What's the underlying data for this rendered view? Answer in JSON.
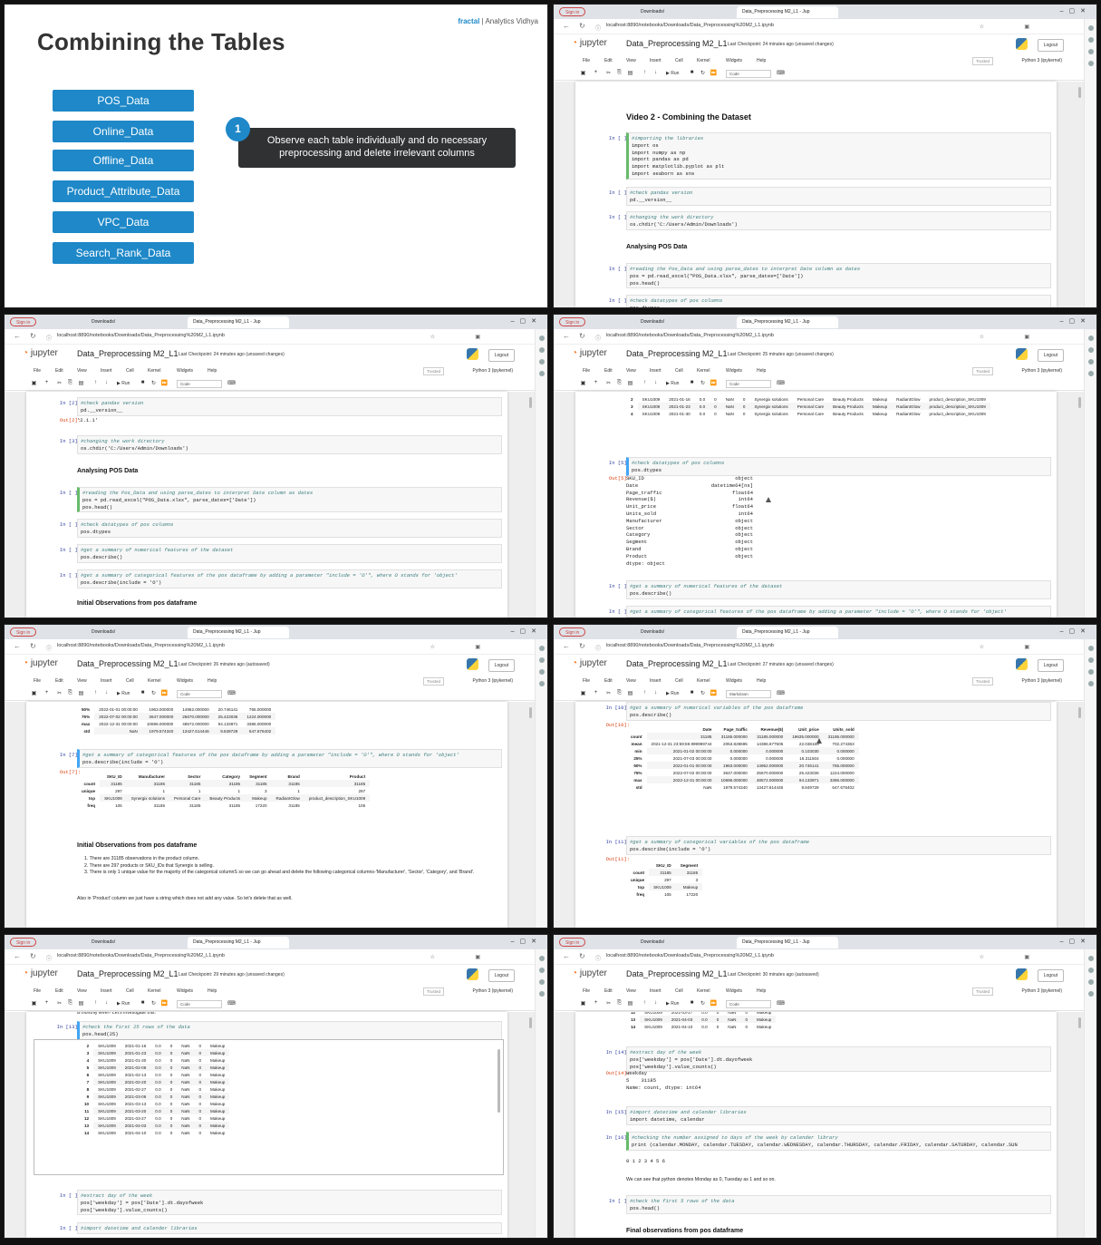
{
  "slide": {
    "title": "Combining the Tables",
    "logo_left": "fractal",
    "logo_right": "Analytics Vidhya",
    "buttons": [
      "POS_Data",
      "Online_Data",
      "Offline_Data",
      "Product_Attribute_Data",
      "VPC_Data",
      "Search_Rank_Data"
    ],
    "step_number": "1",
    "step_text": "Observe each table individually and do necessary preprocessing and delete irrelevant columns"
  },
  "browser": {
    "sign_in": "Sign in",
    "tab_downloads": "Downloads/",
    "tab_notebook": "Data_Preprocessing M2_L1 - Jup",
    "url": "localhost:8890/notebooks/Downloads/Data_Preprocessing%20M2_L1.ipynb"
  },
  "jupyter": {
    "logo": "jupyter",
    "notebook_title": "Data_Preprocessing M2_L1",
    "menu": [
      "File",
      "Edit",
      "View",
      "Insert",
      "Cell",
      "Kernel",
      "Widgets",
      "Help"
    ],
    "trusted": "Trusted",
    "kernel": "Python 3 (ipykernel)",
    "logout": "Logout",
    "run_label": "Run",
    "celltype_code": "Code",
    "celltype_markdown": "Markdown"
  },
  "panels": {
    "p1": {
      "checkpoint": "Last Checkpoint: 24 minutes ago  (unsaved changes)",
      "heading": "Video 2 - Combining the Dataset",
      "cell1_prompt": "In [ ]:",
      "cell1_code": [
        "#importing the libraries",
        "import os",
        "import numpy as np",
        "import pandas as pd",
        "import matplotlib.pyplot as plt",
        "import seaborn as sns"
      ],
      "cell2_prompt": "In [ ]:",
      "cell2_code": [
        "#check pandas version",
        "pd.__version__"
      ],
      "cell3_prompt": "In [ ]:",
      "cell3_code": [
        "#changing the work directory",
        "os.chdir('C:/Users/Admin/Downloads')"
      ],
      "heading2": "Analysing POS Data",
      "cell4_prompt": "In [ ]:",
      "cell4_code": [
        "#reading the Pos_Data and using parse_dates to interpret Date column as dates",
        "pos = pd.read_excel(\"POS_Data.xlsx\", parse_dates=['Date'])",
        "pos.head()"
      ],
      "cell5_prompt": "In [ ]:",
      "cell5_code": [
        "#check datatypes of pos columns",
        "pos.dtypes"
      ]
    },
    "p2": {
      "checkpoint": "Last Checkpoint: 24 minutes ago  (unsaved changes)",
      "c1_prompt": "In [2]:",
      "c1_code": [
        "#check pandas version",
        "pd.__version__"
      ],
      "c1_out_prompt": "Out[2]:",
      "c1_out": "'2.1.1'",
      "c2_prompt": "In [3]:",
      "c2_code": [
        "#changing the work directory",
        "os.chdir('C:/Users/Admin/Downloads')"
      ],
      "heading": "Analysing POS Data",
      "c3_prompt": "In [ ]:",
      "c3_code": [
        "#reading the Pos_Data and using parse_dates to interpret Date column as dates",
        "pos = pd.read_excel(\"POS_Data.xlsx\", parse_dates=['Date'])",
        "pos.head()"
      ],
      "c4_prompt": "In [ ]:",
      "c4_code": [
        "#check datatypes of pos columns",
        "pos.dtypes"
      ],
      "c5_prompt": "In [ ]:",
      "c5_code": [
        "#get a summary of numerical features of the dataset",
        "pos.describe()"
      ],
      "c6_prompt": "In [ ]:",
      "c6_code": [
        "#get a summary of categorical features of the pos dataframe by adding a parameter \"include = 'O'\", where O stands for 'object'",
        "pos.describe(include = 'O')"
      ],
      "heading2": "Initial Observations from pos dataframe"
    },
    "p3": {
      "checkpoint": "Last Checkpoint: 25 minutes ago  (unsaved changes)",
      "head_rows": [
        [
          "2",
          "SKU1009",
          "2021-01-16",
          "0.0",
          "0",
          "NaN",
          "0",
          "Synergix solutions",
          "Personal Care",
          "Beauty Products",
          "Makeup",
          "RadiantGlow",
          "product_description_SKU1009"
        ],
        [
          "3",
          "SKU1009",
          "2021-01-23",
          "0.0",
          "0",
          "NaN",
          "0",
          "Synergix solutions",
          "Personal Care",
          "Beauty Products",
          "Makeup",
          "RadiantGlow",
          "product_description_SKU1009"
        ],
        [
          "4",
          "SKU1009",
          "2021-01-30",
          "0.0",
          "0",
          "NaN",
          "0",
          "Synergix solutions",
          "Personal Care",
          "Beauty Products",
          "Makeup",
          "RadiantGlow",
          "product_description_SKU1009"
        ]
      ],
      "c1_prompt": "In [5]:",
      "c1_code": [
        "#check datatypes of pos columns",
        "pos.dtypes"
      ],
      "c1_out_prompt": "Out[5]:",
      "dtypes": [
        [
          "SKU_ID",
          "object"
        ],
        [
          "Date",
          "datetime64[ns]"
        ],
        [
          "Page_traffic",
          "float64"
        ],
        [
          "Revenue($)",
          "int64"
        ],
        [
          "Unit_price",
          "float64"
        ],
        [
          "Units_sold",
          "int64"
        ],
        [
          "Manufacturer",
          "object"
        ],
        [
          "Sector",
          "object"
        ],
        [
          "Category",
          "object"
        ],
        [
          "Segment",
          "object"
        ],
        [
          "Brand",
          "object"
        ],
        [
          "Product",
          "object"
        ]
      ],
      "dtype_footer": "dtype: object",
      "c2_prompt": "In [ ]:",
      "c2_code": [
        "#get a summary of numerical features of the dataset",
        "pos.describe()"
      ],
      "c3_prompt": "In [ ]:",
      "c3_code": [
        "#get a summary of categorical features of the pos dataframe by adding a parameter \"include = 'O'\", where O stands for 'object'"
      ]
    },
    "p4": {
      "checkpoint": "Last Checkpoint: 26 minutes ago  (autosaved)",
      "num_rows": [
        [
          "50%",
          "2022-01-01 00:00:00",
          "1963.000000",
          "14952.000000",
          "20.746141",
          "765.000000"
        ],
        [
          "75%",
          "2022-07-02 00:00:00",
          "3647.000000",
          "25670.000000",
          "25.423036",
          "1224.000000"
        ],
        [
          "max",
          "2022-12-31 00:00:00",
          "10696.000000",
          "48572.000000",
          "94.133971",
          "3386.000000"
        ],
        [
          "std",
          "NaN",
          "1979.574340",
          "13427.614446",
          "9.849729",
          "647.676402"
        ]
      ],
      "c1_prompt": "In [7]:",
      "c1_code": [
        "#get a summary of categorical features of the pos dataframe by adding a parameter \"include = 'O'\", where O stands for 'object'",
        "pos.describe(include = 'O')"
      ],
      "c1_out_prompt": "Out[7]:",
      "cat_headers": [
        "",
        "SKU_ID",
        "Manufacturer",
        "Sector",
        "Category",
        "Segment",
        "Brand",
        "Product"
      ],
      "cat_rows": [
        [
          "count",
          "31185",
          "31185",
          "31185",
          "31185",
          "31185",
          "31185",
          "31185"
        ],
        [
          "unique",
          "297",
          "1",
          "1",
          "1",
          "3",
          "1",
          "297"
        ],
        [
          "top",
          "SKU1009",
          "Synergix solutions",
          "Personal Care",
          "Beauty Products",
          "Makeup",
          "RadiantGlow",
          "product_description_SKU1009"
        ],
        [
          "freq",
          "105",
          "31185",
          "31185",
          "31185",
          "17220",
          "31185",
          "105"
        ]
      ],
      "heading": "Initial Observations from pos dataframe",
      "obs": [
        "1. There are 31185 observations in the product column.",
        "2. There are 297 products or SKU_IDs that Synergix is selling.",
        "3. There is only 1 unique value for the majority of the categorical columnS so we can go ahead and delete the following categorical columns-'Manufacturer', 'Sector', 'Category', and 'Brand'."
      ],
      "note": "Also in 'Product' column we just have a string which does not add any value. So let's delete that as well."
    },
    "p5": {
      "checkpoint": "Last Checkpoint: 27 minutes ago  (unsaved changes)",
      "c1_prompt": "In [10]:",
      "c1_code": [
        "#get a summary of numerical variables of the pos dataframe",
        "pos.describe()"
      ],
      "c1_out_prompt": "Out[10]:",
      "num_headers": [
        "",
        "Date",
        "Page_traffic",
        "Revenue($)",
        "Unit_price",
        "Units_sold"
      ],
      "num_rows": [
        [
          "count",
          "31185",
          "31185.000000",
          "31185.000000",
          "19635.000000",
          "31185.000000"
        ],
        [
          "mean",
          "2021-12-31 23:59:59.999999744",
          "2053.828695",
          "14386.677505",
          "22.038169",
          "702.274363"
        ],
        [
          "min",
          "2021-01-02 00:00:00",
          "0.000000",
          "0.000000",
          "0.103030",
          "0.000000"
        ],
        [
          "25%",
          "2021-07-03 00:00:00",
          "0.000000",
          "0.000000",
          "16.311504",
          "0.000000"
        ],
        [
          "50%",
          "2022-01-01 00:00:00",
          "1963.000000",
          "14952.000000",
          "20.746141",
          "765.000000"
        ],
        [
          "75%",
          "2022-07-02 00:00:00",
          "3647.000000",
          "25670.000000",
          "25.423036",
          "1224.000000"
        ],
        [
          "max",
          "2022-12-31 00:00:00",
          "10696.000000",
          "48572.000000",
          "94.133971",
          "3386.000000"
        ],
        [
          "std",
          "NaN",
          "1979.574340",
          "13427.614446",
          "9.849729",
          "647.676402"
        ]
      ],
      "c2_prompt": "In [11]:",
      "c2_code": [
        "#get a summary of categorical variables of the pos dataframe",
        "pos.describe(include = 'O')"
      ],
      "c2_out_prompt": "Out[11]:",
      "cat_headers": [
        "",
        "SKU_ID",
        "Segment"
      ],
      "cat_rows": [
        [
          "count",
          "31185",
          "31185"
        ],
        [
          "unique",
          "297",
          "3"
        ],
        [
          "top",
          "SKU1009",
          "Makeup"
        ],
        [
          "freq",
          "105",
          "17220"
        ]
      ]
    },
    "p6": {
      "checkpoint": "Last Checkpoint: 29 minutes ago  (unsaved changes)",
      "lead": "a monthly level? Let's investigate this.",
      "c1_prompt": "In [13]:",
      "c1_code": [
        "#check the first 25 rows of the data",
        "pos.head(25)"
      ],
      "rows": [
        [
          "2",
          "SKU1009",
          "2021-01-16",
          "0.0",
          "0",
          "NaN",
          "0",
          "Makeup"
        ],
        [
          "3",
          "SKU1009",
          "2021-01-23",
          "0.0",
          "0",
          "NaN",
          "0",
          "Makeup"
        ],
        [
          "4",
          "SKU1009",
          "2021-01-30",
          "0.0",
          "0",
          "NaN",
          "0",
          "Makeup"
        ],
        [
          "5",
          "SKU1009",
          "2021-02-06",
          "0.0",
          "0",
          "NaN",
          "0",
          "Makeup"
        ],
        [
          "6",
          "SKU1009",
          "2021-02-13",
          "0.0",
          "0",
          "NaN",
          "0",
          "Makeup"
        ],
        [
          "7",
          "SKU1009",
          "2021-02-20",
          "0.0",
          "0",
          "NaN",
          "0",
          "Makeup"
        ],
        [
          "8",
          "SKU1009",
          "2021-02-27",
          "0.0",
          "0",
          "NaN",
          "0",
          "Makeup"
        ],
        [
          "9",
          "SKU1009",
          "2021-03-06",
          "0.0",
          "0",
          "NaN",
          "0",
          "Makeup"
        ],
        [
          "10",
          "SKU1009",
          "2021-03-13",
          "0.0",
          "0",
          "NaN",
          "0",
          "Makeup"
        ],
        [
          "11",
          "SKU1009",
          "2021-03-20",
          "0.0",
          "0",
          "NaN",
          "0",
          "Makeup"
        ],
        [
          "12",
          "SKU1009",
          "2021-03-27",
          "0.0",
          "0",
          "NaN",
          "0",
          "Makeup"
        ],
        [
          "13",
          "SKU1009",
          "2021-04-03",
          "0.0",
          "0",
          "NaN",
          "0",
          "Makeup"
        ],
        [
          "14",
          "SKU1009",
          "2021-04-10",
          "0.0",
          "0",
          "NaN",
          "0",
          "Makeup"
        ]
      ],
      "c2_prompt": "In [ ]:",
      "c2_code": [
        "#extract day of the week",
        "pos['weekday'] = pos['Date'].dt.dayofweek",
        "pos['weekday'].value_counts()"
      ],
      "c3_prompt": "In [ ]:",
      "c3_code": [
        "#import datetime and calender libraries"
      ]
    },
    "p7": {
      "checkpoint": "Last Checkpoint: 30 minutes ago  (autosaved)",
      "rows": [
        [
          "12",
          "SKU1009",
          "2021-03-27",
          "0.0",
          "0",
          "NaN",
          "0",
          "Makeup"
        ],
        [
          "13",
          "SKU1009",
          "2021-04-03",
          "0.0",
          "0",
          "NaN",
          "0",
          "Makeup"
        ],
        [
          "14",
          "SKU1009",
          "2021-04-10",
          "0.0",
          "0",
          "NaN",
          "0",
          "Makeup"
        ]
      ],
      "c1_prompt": "In [14]:",
      "c1_code": [
        "#extract day of the week",
        "pos['weekday'] = pos['Date'].dt.dayofweek",
        "pos['weekday'].value_counts()"
      ],
      "c1_out_prompt": "Out[14]:",
      "c1_out": [
        "weekday",
        "5    31185",
        "Name: count, dtype: int64"
      ],
      "c2_prompt": "In [15]:",
      "c2_code": [
        "#import datetime and calender libraries",
        "import datetime, calendar"
      ],
      "c3_prompt": "In [16]:",
      "c3_code": [
        "#checking the number assigned to days of the week by calender library",
        "print (calendar.MONDAY, calendar.TUESDAY, calendar.WEDNESDAY, calendar.THURSDAY, calendar.FRIDAY, calendar.SATURDAY, calendar.SUN"
      ],
      "c3_out": "0 1 2 3 4 5 6",
      "note": "We can see that python denotes Monday as 0, Tuesday as 1 and so on.",
      "c4_prompt": "In [ ]:",
      "c4_code": [
        "#check the first 5 rows of the data",
        "pos.head()"
      ],
      "heading": "Final observations from pos dataframe"
    }
  }
}
